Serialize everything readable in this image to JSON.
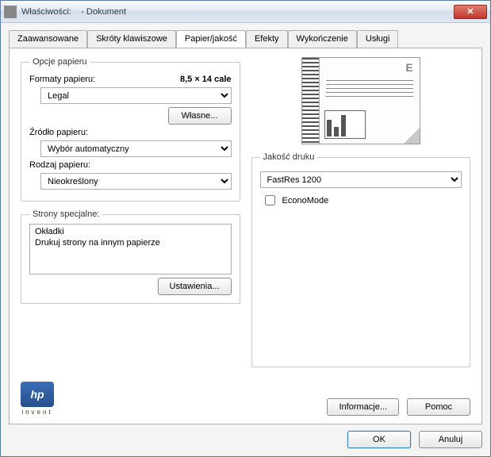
{
  "window": {
    "title_prefix": "Właściwości:",
    "title_suffix": "- Dokument"
  },
  "tabs": {
    "advanced": "Zaawansowane",
    "shortcuts": "Skróty klawiszowe",
    "paper": "Papier/jakość",
    "effects": "Efekty",
    "finishing": "Wykończenie",
    "services": "Usługi"
  },
  "paper_options": {
    "legend": "Opcje papieru",
    "format_label": "Formaty papieru:",
    "size_display": "8,5 × 14 cale",
    "format_value": "Legal",
    "custom_btn": "Własne...",
    "source_label": "Źródło papieru:",
    "source_value": "Wybór automatyczny",
    "type_label": "Rodzaj papieru:",
    "type_value": "Nieokreślony"
  },
  "special_pages": {
    "legend": "Strony specjalne:",
    "items": {
      "covers": "Okładki",
      "print_on_different": "Drukuj strony na innym papierze"
    },
    "settings_btn": "Ustawienia..."
  },
  "preview": {
    "badge": "E"
  },
  "quality": {
    "legend": "Jakość druku",
    "value": "FastRes 1200",
    "econo_label": "EconoMode"
  },
  "brand": {
    "name": "hp",
    "sub": "invent"
  },
  "buttons": {
    "info": "Informacje...",
    "help": "Pomoc",
    "ok": "OK",
    "cancel": "Anuluj"
  }
}
